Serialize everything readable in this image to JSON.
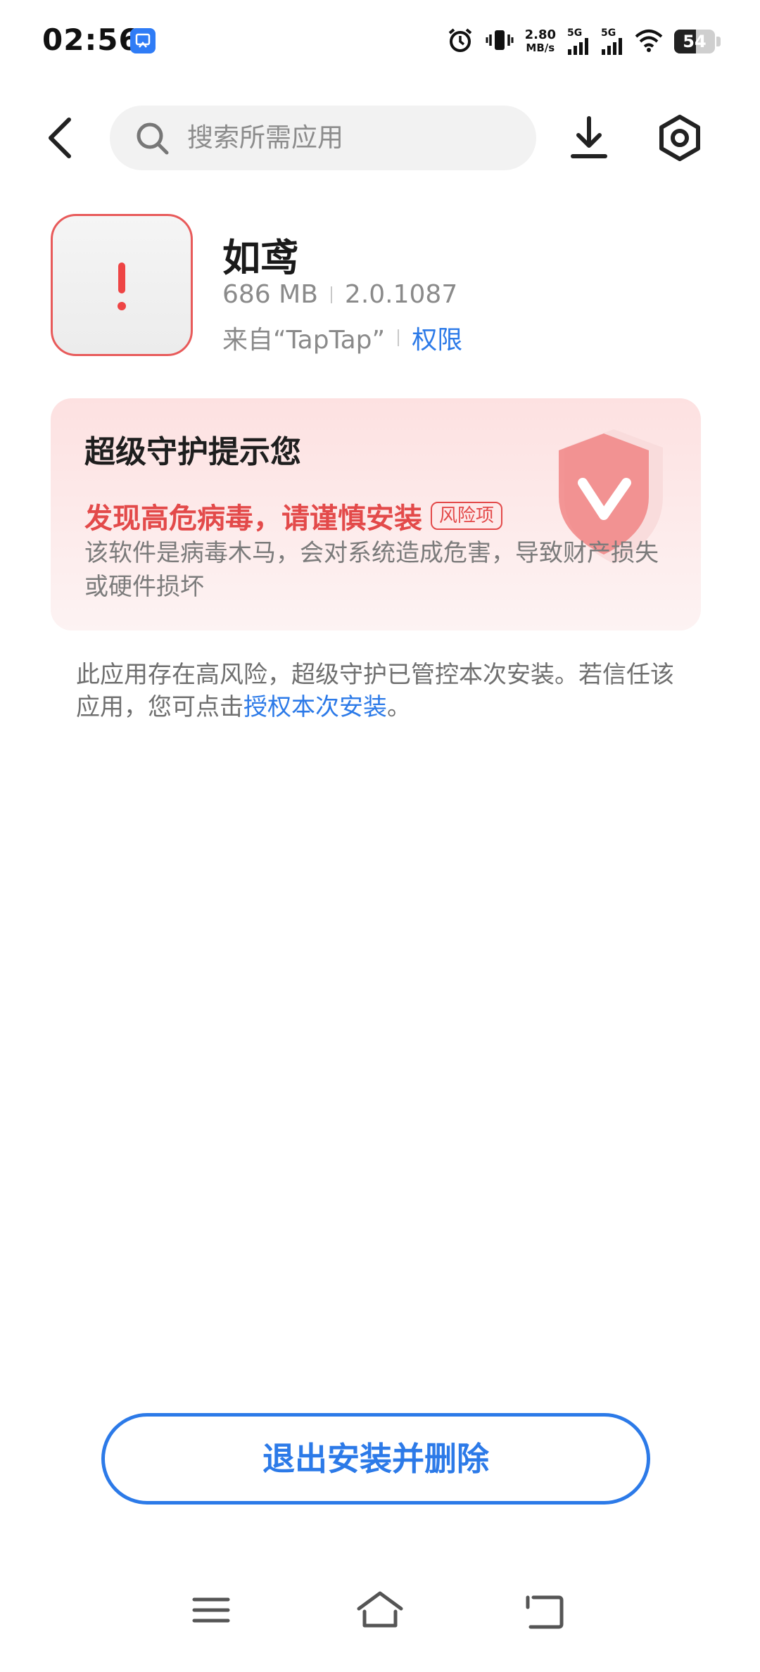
{
  "status_bar": {
    "time": "02:56",
    "net_speed_value": "2.80",
    "net_speed_unit": "MB/s",
    "sim1_label": "5G",
    "sim2_label": "5G",
    "battery_level": "54",
    "battery_fraction": 0.54
  },
  "header": {
    "search_placeholder": "搜索所需应用",
    "icons": [
      "back-arrow-icon",
      "search-icon",
      "download-icon",
      "settings-hexagon-icon"
    ]
  },
  "app": {
    "name": "如鸢",
    "size": "686 MB",
    "version": "2.0.1087",
    "source": "来自“TapTap”",
    "permissions_link": "权限"
  },
  "warning_card": {
    "title": "超级守护提示您",
    "alert": "发现高危病毒，请谨慎安装",
    "risk_badge": "风险项",
    "description": "该软件是病毒木马，会对系统造成危害，导致财产损失或硬件损坏"
  },
  "notice": {
    "text_before": "此应用存在高风险，超级守护已管控本次安装。若信任该应用，您可点击",
    "link": "授权本次安装",
    "text_after": "。"
  },
  "actions": {
    "exit_button": "退出安装并删除"
  },
  "colors": {
    "accent_blue": "#2c7ae8",
    "danger_red": "#e34a4a",
    "card_bg": "#fde1e1"
  }
}
